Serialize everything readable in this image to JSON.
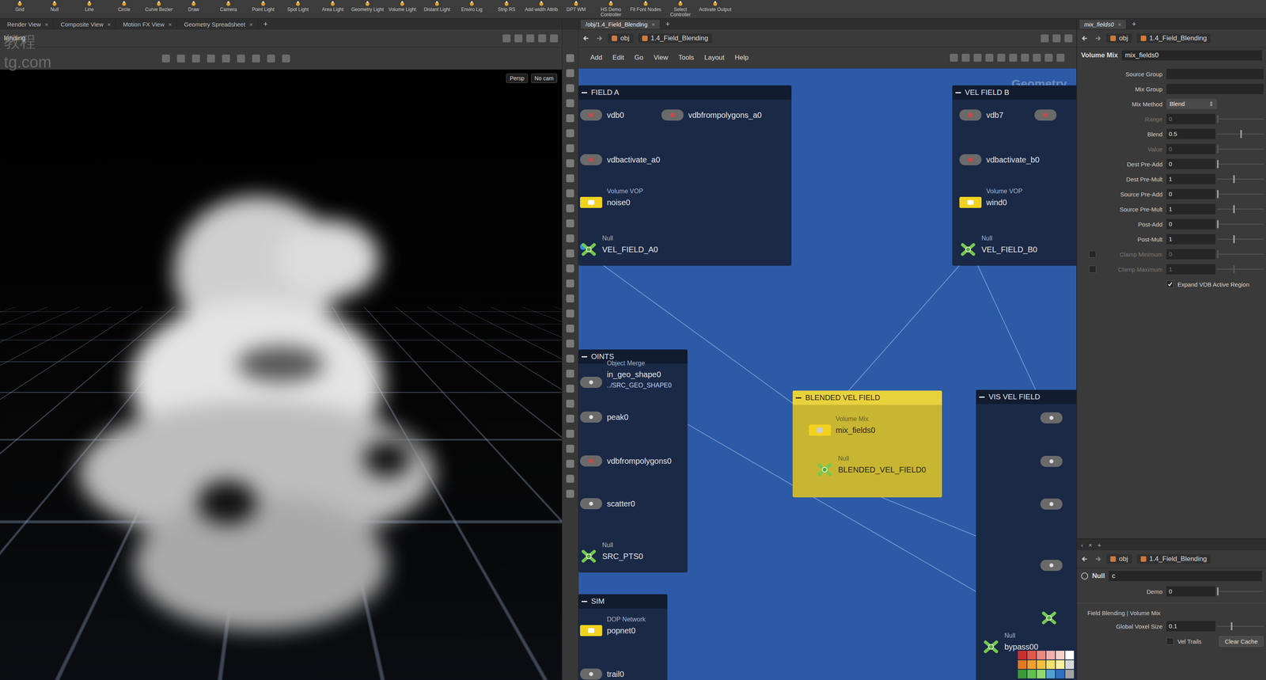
{
  "shelf": [
    "Grid",
    "Null",
    "Line",
    "Circle",
    "Curve Bezier",
    "Draw",
    "Camera",
    "Point Light",
    "Spot Light",
    "Area Light",
    "Geometry Light",
    "Volume Light",
    "Distant Light",
    "Enviro Lig",
    "Strip RS",
    "Add width Attrib",
    "DPT WM",
    "HS Demo Controller",
    "Fit Font Nodes",
    "Select Controller",
    "Activate Output"
  ],
  "left_tabs": [
    {
      "label": "Render View",
      "selected": false
    },
    {
      "label": "Composite View",
      "selected": false
    },
    {
      "label": "Motion FX View",
      "selected": false
    },
    {
      "label": "Geometry Spreadsheet",
      "selected": false
    }
  ],
  "tab_close": "×",
  "tab_add": "+",
  "viewport": {
    "path": "lending",
    "watermark": [
      "教程",
      "tg.com"
    ],
    "persp": "Persp",
    "cam": "No cam"
  },
  "network": {
    "tabs": [
      {
        "label": "/obj/1.4_Field_Blending",
        "selected": true
      }
    ],
    "path": [
      "obj",
      "1.4_Field_Blending"
    ],
    "menu": [
      "Add",
      "Edit",
      "Go",
      "View",
      "Tools",
      "Layout",
      "Help"
    ],
    "context": "Geometry",
    "boxes": [
      {
        "title": "FIELD A",
        "color": "#1a2946",
        "nodes": [
          {
            "kind": "vdb",
            "name": "vdb0"
          },
          {
            "kind": "vdb",
            "name": "vdbfrompolygons_a0"
          },
          {
            "kind": "vdb",
            "name": "vdbactivate_a0"
          },
          {
            "kind": "vop",
            "type": "Volume VOP",
            "name": "noise0"
          },
          {
            "kind": "null",
            "type": "Null",
            "name": "VEL_FIELD_A0",
            "color": "#2f8fe8"
          }
        ]
      },
      {
        "title": "VEL FIELD B",
        "color": "#1a2946",
        "nodes": [
          {
            "kind": "vdb",
            "name": "vdb7"
          },
          {
            "kind": "vdb"
          },
          {
            "kind": "vdb",
            "name": "vdbactivate_b0"
          },
          {
            "kind": "vop",
            "type": "Volume VOP",
            "name": "wind0"
          },
          {
            "kind": "null",
            "type": "Null",
            "name": "VEL_FIELD_B0"
          }
        ]
      },
      {
        "title": "OINTS",
        "color": "#1a2946",
        "nodes": [
          {
            "kind": "merge",
            "type": "Object Merge",
            "name": "in_geo_shape0",
            "sub": "../SRC_GEO_SHAPE0"
          },
          {
            "kind": "sop",
            "name": "peak0"
          },
          {
            "kind": "vdb",
            "name": "vdbfrompolygons0"
          },
          {
            "kind": "sop",
            "name": "scatter0"
          },
          {
            "kind": "null",
            "type": "Null",
            "name": "SRC_PTS0"
          }
        ]
      },
      {
        "title": "SIM",
        "color": "#1a2946",
        "nodes": [
          {
            "kind": "dop",
            "type": "DOP Network",
            "name": "popnet0"
          },
          {
            "kind": "sop",
            "name": "trail0"
          }
        ]
      },
      {
        "title": "BLENDED VEL FIELD",
        "color": "#c8b632",
        "nodes": [
          {
            "kind": "mix",
            "type": "Volume Mix",
            "name": "mix_fields0"
          },
          {
            "kind": "null",
            "type": "Null",
            "name": "BLENDED_VEL_FIELD0"
          }
        ]
      },
      {
        "title": "VIS VEL FIELD",
        "color": "#1a2946",
        "nodes": [
          {
            "kind": "sop"
          },
          {
            "kind": "sop"
          },
          {
            "kind": "sop"
          },
          {
            "kind": "sop"
          },
          {
            "kind": "null"
          },
          {
            "kind": "null",
            "type": "Null",
            "name": "bypass00"
          }
        ],
        "palette": [
          "#c83030",
          "#e05a4a",
          "#e88a80",
          "#f2b0b0",
          "#f6d0c8",
          "#ffffff",
          "#e07a20",
          "#f0a030",
          "#f4c040",
          "#f8e070",
          "#fff0a0",
          "#d8d8d8",
          "#3a9a3a",
          "#60c050",
          "#90d870",
          "#50a0d0",
          "#3070c0",
          "#a0a0a0"
        ]
      }
    ]
  },
  "params": {
    "tab": "mix_fields0",
    "path": [
      "obj",
      "1.4_Field_Blending"
    ],
    "node_type": "Volume Mix",
    "node_name": "mix_fields0",
    "rows": [
      {
        "label": "Source Group",
        "kind": "field",
        "value": "",
        "disabled": false
      },
      {
        "label": "Mix Group",
        "kind": "field",
        "value": "",
        "disabled": false
      },
      {
        "label": "Mix Method",
        "kind": "menu",
        "value": "Blend",
        "disabled": false
      },
      {
        "label": "Range",
        "kind": "slider",
        "value": "0",
        "level": 0,
        "disabled": true
      },
      {
        "label": "Blend",
        "kind": "slider",
        "value": "0.5",
        "level": 0.5,
        "disabled": false
      },
      {
        "label": "Value",
        "kind": "slider",
        "value": "0",
        "level": 0,
        "disabled": true
      },
      {
        "label": "Dest Pre-Add",
        "kind": "slider",
        "value": "0",
        "level": 0,
        "disabled": false
      },
      {
        "label": "Dest Pre-Mult",
        "kind": "slider",
        "value": "1",
        "level": 0.35,
        "disabled": false
      },
      {
        "label": "Source Pre-Add",
        "kind": "slider",
        "value": "0",
        "level": 0,
        "disabled": false
      },
      {
        "label": "Source Pre-Mult",
        "kind": "slider",
        "value": "1",
        "level": 0.35,
        "disabled": false
      },
      {
        "label": "Post-Add",
        "kind": "slider",
        "value": "0",
        "level": 0,
        "disabled": false
      },
      {
        "label": "Post-Mult",
        "kind": "slider",
        "value": "1",
        "level": 0.35,
        "disabled": false
      },
      {
        "label": "Clamp Minimum",
        "kind": "clamp",
        "value": "0",
        "level": 0,
        "disabled": true,
        "checked": false
      },
      {
        "label": "Clamp Maximum",
        "kind": "clamp",
        "value": "1",
        "level": 0.35,
        "disabled": true,
        "checked": false
      },
      {
        "label": "Expand VDB Active Region",
        "kind": "toggle",
        "disabled": false,
        "checked": true
      }
    ]
  },
  "lower": {
    "tabs": [
      "‹",
      "×",
      "+"
    ],
    "path": [
      "obj",
      "1.4_Field_Blending"
    ],
    "node_type": "Null",
    "node_name": "c",
    "demo": {
      "label": "Demo",
      "value": "0",
      "level": 0
    },
    "folder": "Field Blending | Volume Mix",
    "voxel": {
      "label": "Global Voxel Size",
      "value": "0.1",
      "level": 0.3
    },
    "trails": {
      "label": "Vel Trails",
      "checked": false
    },
    "button": "Clear Cache"
  }
}
